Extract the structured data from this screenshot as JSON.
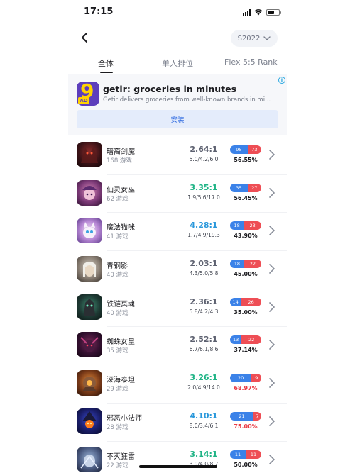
{
  "status_bar": {
    "time": "17:15"
  },
  "header": {
    "season": "S2022"
  },
  "tabs": [
    {
      "label": "全体",
      "active": true
    },
    {
      "label": "单人排位",
      "active": false
    },
    {
      "label": "Flex 5:5 Rank",
      "active": false
    }
  ],
  "ad": {
    "title": "getir: groceries in minutes",
    "description": "Getir delivers groceries from well-known brands in mi...",
    "badge": "AD",
    "install_label": "安装"
  },
  "colors": {
    "kda_gray": "#5d6170",
    "kda_green": "#20b486",
    "kda_blue": "#2a98db",
    "rate_red": "#ea3b44",
    "win_blue": "#3b82e8",
    "loss_red": "#ee4e55"
  },
  "champions": [
    {
      "name": "暗裔剑魔",
      "games": "168 游戏",
      "kda": "2.64:1",
      "kda_detail": "5.0/4.2/6.0",
      "wins": "95",
      "losses": "73",
      "win_fraction": 0.5655,
      "win_rate": "56.55%",
      "kda_color": "#5d6170",
      "rate_color": "#1b1b1f"
    },
    {
      "name": "仙灵女巫",
      "games": "62 游戏",
      "kda": "3.35:1",
      "kda_detail": "1.9/5.6/17.0",
      "wins": "35",
      "losses": "27",
      "win_fraction": 0.5645,
      "win_rate": "56.45%",
      "kda_color": "#20b486",
      "rate_color": "#1b1b1f"
    },
    {
      "name": "魔法猫咪",
      "games": "41 游戏",
      "kda": "4.28:1",
      "kda_detail": "1.7/4.9/19.3",
      "wins": "18",
      "losses": "23",
      "win_fraction": 0.439,
      "win_rate": "43.90%",
      "kda_color": "#2a98db",
      "rate_color": "#1b1b1f"
    },
    {
      "name": "青钢影",
      "games": "40 游戏",
      "kda": "2.03:1",
      "kda_detail": "4.3/5.0/5.8",
      "wins": "18",
      "losses": "22",
      "win_fraction": 0.45,
      "win_rate": "45.00%",
      "kda_color": "#5d6170",
      "rate_color": "#1b1b1f"
    },
    {
      "name": "铁铠冥魂",
      "games": "40 游戏",
      "kda": "2.36:1",
      "kda_detail": "5.8/4.2/4.3",
      "wins": "14",
      "losses": "26",
      "win_fraction": 0.35,
      "win_rate": "35.00%",
      "kda_color": "#5d6170",
      "rate_color": "#1b1b1f"
    },
    {
      "name": "蜘蛛女皇",
      "games": "35 游戏",
      "kda": "2.52:1",
      "kda_detail": "6.7/6.1/8.6",
      "wins": "13",
      "losses": "22",
      "win_fraction": 0.3714,
      "win_rate": "37.14%",
      "kda_color": "#5d6170",
      "rate_color": "#1b1b1f"
    },
    {
      "name": "深海泰坦",
      "games": "29 游戏",
      "kda": "3.26:1",
      "kda_detail": "2.0/4.9/14.0",
      "wins": "20",
      "losses": "9",
      "win_fraction": 0.6897,
      "win_rate": "68.97%",
      "kda_color": "#20b486",
      "rate_color": "#ea3b44"
    },
    {
      "name": "邪恶小法师",
      "games": "28 游戏",
      "kda": "4.10:1",
      "kda_detail": "8.0/3.4/6.1",
      "wins": "21",
      "losses": "7",
      "win_fraction": 0.75,
      "win_rate": "75.00%",
      "kda_color": "#2a98db",
      "rate_color": "#ea3b44"
    },
    {
      "name": "不灭狂雷",
      "games": "22 游戏",
      "kda": "3.14:1",
      "kda_detail": "3.9/4.0/8.7",
      "wins": "11",
      "losses": "11",
      "win_fraction": 0.5,
      "win_rate": "50.00%",
      "kda_color": "#20b486",
      "rate_color": "#1b1b1f"
    }
  ]
}
